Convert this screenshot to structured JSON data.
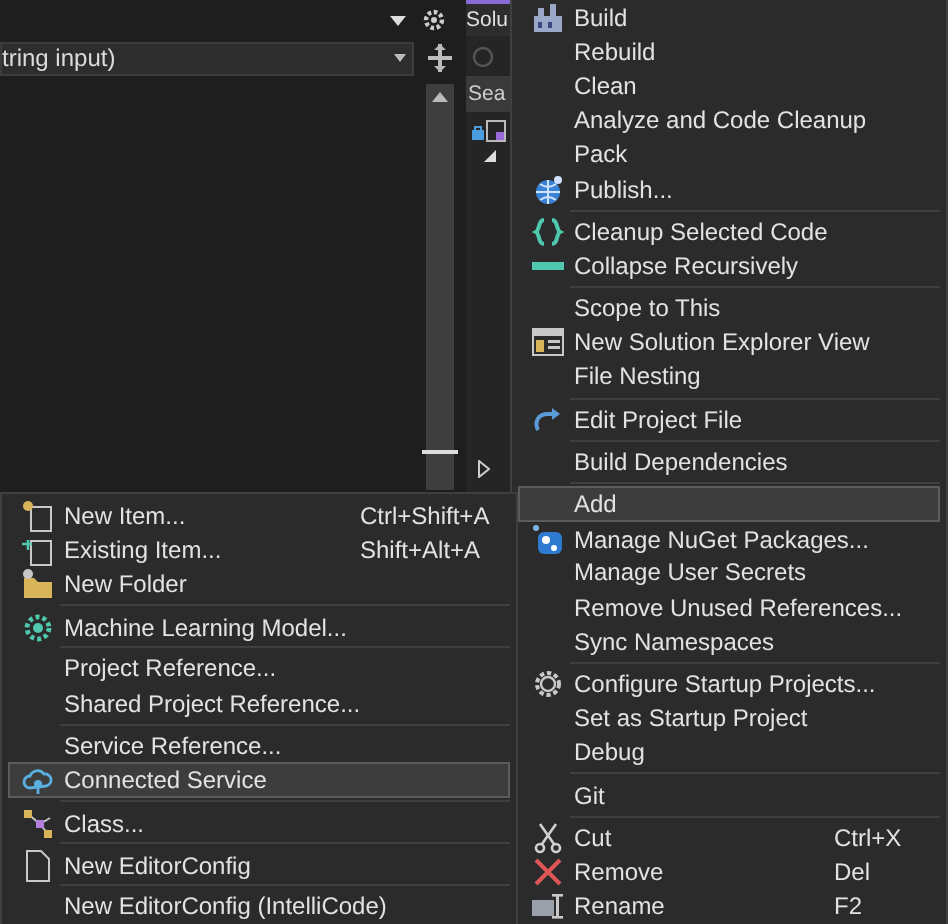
{
  "editor": {
    "dropdown": {
      "value": "tring input)"
    }
  },
  "solution_explorer": {
    "tab": {
      "label": "Solu",
      "selected": true
    },
    "search": {
      "placeholder": "Sea"
    }
  },
  "context_menu": {
    "groups": [
      [
        {
          "label": "Build",
          "selected": false
        },
        {
          "label": "Rebuild",
          "selected": false
        },
        {
          "label": "Clean",
          "selected": false
        },
        {
          "label": "Analyze and Code Cleanup",
          "selected": false
        },
        {
          "label": "Pack",
          "selected": false
        },
        {
          "label": "Publish...",
          "selected": false
        }
      ],
      [
        {
          "label": "Cleanup Selected Code",
          "selected": false
        },
        {
          "label": "Collapse Recursively",
          "selected": false
        }
      ],
      [
        {
          "label": "Scope to This",
          "selected": false
        },
        {
          "label": "New Solution Explorer View",
          "selected": false
        },
        {
          "label": "File Nesting",
          "selected": false
        }
      ],
      [
        {
          "label": "Edit Project File",
          "selected": false
        }
      ],
      [
        {
          "label": "Build Dependencies",
          "selected": false
        }
      ],
      [
        {
          "label": "Add",
          "selected": true
        },
        {
          "label": "Manage NuGet Packages...",
          "selected": false
        },
        {
          "label": "Manage User Secrets",
          "selected": false
        },
        {
          "label": "Remove Unused References...",
          "selected": false
        },
        {
          "label": "Sync Namespaces",
          "selected": false
        }
      ],
      [
        {
          "label": "Configure Startup Projects...",
          "selected": false
        },
        {
          "label": "Set as Startup Project",
          "selected": false
        },
        {
          "label": "Debug",
          "selected": false
        }
      ],
      [
        {
          "label": "Git",
          "selected": false
        }
      ],
      [
        {
          "label": "Cut",
          "shortcut": "Ctrl+X",
          "selected": false
        },
        {
          "label": "Remove",
          "shortcut": "Del",
          "selected": false
        },
        {
          "label": "Rename",
          "shortcut": "F2",
          "selected": false
        }
      ]
    ]
  },
  "add_submenu": {
    "groups": [
      [
        {
          "label": "New Item...",
          "shortcut": "Ctrl+Shift+A",
          "selected": false
        },
        {
          "label": "Existing Item...",
          "shortcut": "Shift+Alt+A",
          "selected": false
        },
        {
          "label": "New Folder",
          "selected": false
        }
      ],
      [
        {
          "label": "Machine Learning Model...",
          "selected": false
        }
      ],
      [
        {
          "label": "Project Reference...",
          "selected": false
        },
        {
          "label": "Shared Project Reference...",
          "selected": false
        }
      ],
      [
        {
          "label": "Service Reference...",
          "selected": false
        },
        {
          "label": "Connected Service",
          "selected": true
        }
      ],
      [
        {
          "label": "Class...",
          "selected": false
        }
      ],
      [
        {
          "label": "New EditorConfig",
          "selected": false
        }
      ],
      [
        {
          "label": "New EditorConfig (IntelliCode)",
          "selected": false
        }
      ]
    ]
  }
}
